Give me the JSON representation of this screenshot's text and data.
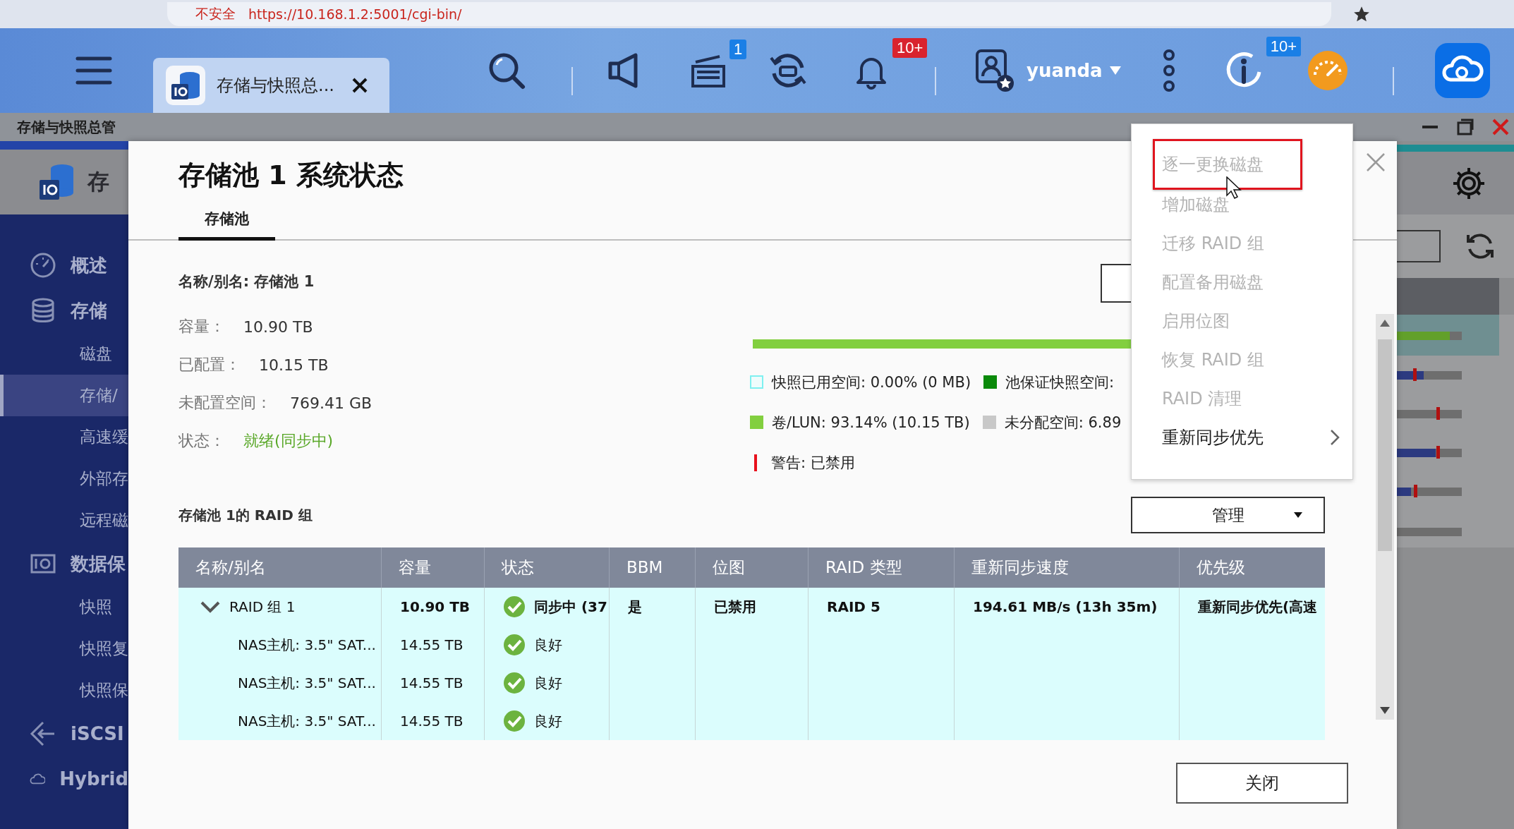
{
  "browser": {
    "security_label": "不安全",
    "url": "https://10.168.1.2:5001/cgi-bin/"
  },
  "topbar": {
    "app_tab": {
      "label": "存储与快照总...",
      "selected": true
    },
    "icons": [
      {
        "kind": "search"
      },
      {
        "kind": "megaphone"
      },
      {
        "kind": "tasks",
        "badge": {
          "text": "1",
          "color": "#1a7fe6"
        }
      },
      {
        "kind": "sync"
      },
      {
        "kind": "bell",
        "badge": {
          "text": "10+",
          "color": "#d9232e"
        }
      },
      {
        "kind": "user",
        "label": "yuanda"
      },
      {
        "kind": "more"
      },
      {
        "kind": "info",
        "badge": {
          "text": "10+",
          "color": "#1a7fe6"
        }
      },
      {
        "kind": "speedometer"
      },
      {
        "kind": "cloud"
      }
    ]
  },
  "app_window": {
    "title": "存储与快照总管"
  },
  "sidebar": {
    "header": "存",
    "items": [
      {
        "label": "概述",
        "kind": "section"
      },
      {
        "label": "存储",
        "kind": "section"
      },
      {
        "label": "磁盘",
        "kind": "item",
        "selected": false
      },
      {
        "label": "存储/",
        "kind": "item",
        "selected": true
      },
      {
        "label": "高速缓",
        "kind": "item",
        "selected": false
      },
      {
        "label": "外部存",
        "kind": "item",
        "selected": false
      },
      {
        "label": "远程磁",
        "kind": "item",
        "selected": false
      },
      {
        "label": "数据保",
        "kind": "section"
      },
      {
        "label": "快照",
        "kind": "item",
        "selected": false
      },
      {
        "label": "快照复",
        "kind": "item",
        "selected": false
      },
      {
        "label": "快照保",
        "kind": "item",
        "selected": false
      },
      {
        "label": "iSCSI",
        "kind": "section"
      },
      {
        "label": "Hybrid",
        "kind": "section"
      }
    ]
  },
  "dialog": {
    "title": "存储池 1 系统状态",
    "tabs": [
      {
        "label": "存储池",
        "selected": true
      }
    ],
    "name_line": "名称/别名: 存储池 1",
    "fields": [
      {
        "label": "容量：",
        "value": "10.90 TB",
        "kind": "plain"
      },
      {
        "label": "已配置：",
        "value": "10.15 TB",
        "kind": "plain"
      },
      {
        "label": "未配置空间：",
        "value": "769.41 GB",
        "kind": "plain"
      },
      {
        "label": "状态：",
        "value": "就绪(同步中)",
        "kind": "status"
      }
    ],
    "legend": [
      [
        {
          "label": "快照已用空间: 0.00% (0 MB)",
          "color": "#7ff0f0",
          "kind": "outline"
        },
        {
          "label": "池保证快照空间:",
          "color": "#0a8a0a",
          "kind": "fill"
        }
      ],
      [
        {
          "label": "卷/LUN: 93.14% (10.15 TB)",
          "color": "#82cf3f",
          "kind": "fill"
        },
        {
          "label": "未分配空间: 6.89",
          "color": "#c8c8c8",
          "kind": "fill"
        }
      ],
      [
        {
          "label": "警告: 已禁用",
          "color": "#e8101c",
          "kind": "line"
        }
      ]
    ],
    "raid_heading": "存储池 1的 RAID 组",
    "manage_button": "管理",
    "table": {
      "columns": [
        "名称/别名",
        "容量",
        "状态",
        "BBM",
        "位图",
        "RAID 类型",
        "重新同步速度",
        "优先级"
      ],
      "rows": [
        {
          "kind": "group",
          "name": "RAID 组 1",
          "expanded": true,
          "capacity": "10.90 TB",
          "status": {
            "kind": "ok",
            "text": "同步中 (37"
          },
          "bbm": "是",
          "bitmap": "已禁用",
          "raid_type": "RAID 5",
          "resync_speed": "194.61 MB/s (13h 35m)",
          "priority": "重新同步优先(高速",
          "children": [
            {
              "name": "NAS主机: 3.5\" SAT...",
              "capacity": "14.55 TB",
              "status": {
                "kind": "ok",
                "text": "良好"
              }
            },
            {
              "name": "NAS主机: 3.5\" SAT...",
              "capacity": "14.55 TB",
              "status": {
                "kind": "ok",
                "text": "良好"
              }
            },
            {
              "name": "NAS主机: 3.5\" SAT...",
              "capacity": "14.55 TB",
              "status": {
                "kind": "ok",
                "text": "良好"
              }
            }
          ]
        }
      ]
    },
    "close_button": "关闭"
  },
  "menu": {
    "items": [
      {
        "label": "逐一更换磁盘",
        "disabled": true,
        "highlighted": true,
        "submenu": false
      },
      {
        "label": "增加磁盘",
        "disabled": true,
        "highlighted": false,
        "submenu": false
      },
      {
        "label": "迁移 RAID 组",
        "disabled": true,
        "highlighted": false,
        "submenu": false
      },
      {
        "label": "配置备用磁盘",
        "disabled": true,
        "highlighted": false,
        "submenu": false
      },
      {
        "label": "启用位图",
        "disabled": true,
        "highlighted": false,
        "submenu": false
      },
      {
        "label": "恢复 RAID 组",
        "disabled": true,
        "highlighted": false,
        "submenu": false
      },
      {
        "label": "RAID 清理",
        "disabled": true,
        "highlighted": false,
        "submenu": false
      },
      {
        "label": "重新同步优先",
        "disabled": false,
        "highlighted": false,
        "submenu": true
      }
    ]
  }
}
